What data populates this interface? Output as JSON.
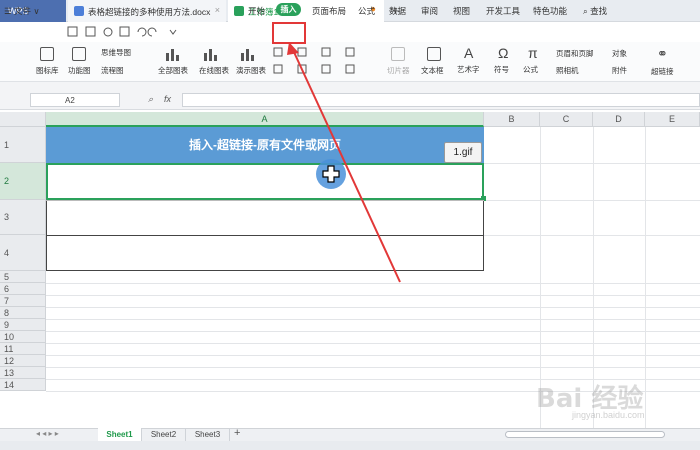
{
  "tabs": {
    "app": "WPS",
    "doc1": "表格超链接的多种使用方法.docx",
    "doc2": "工作簿1",
    "close": "×",
    "modified": "●",
    "add": "+"
  },
  "menu": {
    "file": "☰ 文件 ∨",
    "items": [
      "开始",
      "插入",
      "页面布局",
      "公式",
      "数据",
      "审阅",
      "视图",
      "开发工具",
      "特色功能",
      "查找"
    ]
  },
  "ribbon": {
    "items": [
      "图标库",
      "功能图",
      "思维导图",
      "流程图",
      "全部图表",
      "在线图表",
      "演示图表",
      "切片器",
      "文本框",
      "艺术字",
      "符号",
      "公式",
      "页眉和页脚",
      "照相机",
      "对象",
      "附件",
      "超链接"
    ]
  },
  "formula_bar": {
    "cell_ref": "A2",
    "fx_label": "fx",
    "value": ""
  },
  "grid": {
    "columns": [
      "A",
      "B",
      "C",
      "D",
      "E"
    ],
    "rows": [
      "1",
      "2",
      "3",
      "4",
      "5",
      "6",
      "7",
      "8",
      "9",
      "10",
      "11",
      "12",
      "13",
      "14"
    ],
    "title_cell": "插入-超链接-原有文件或网页",
    "badge": "1.gif"
  },
  "sheets": {
    "tabs": [
      "Sheet1",
      "Sheet2",
      "Sheet3"
    ],
    "add": "+"
  },
  "watermark": {
    "main": "Bai 经验",
    "sub": "jingyan.baidu.com"
  },
  "colors": {
    "accent": "#2aa15b",
    "title_fill": "#5b9bd5",
    "annotation": "#e23838"
  }
}
